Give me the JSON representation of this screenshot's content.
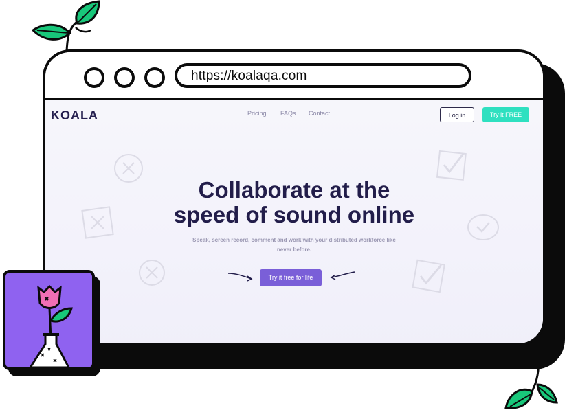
{
  "browser": {
    "url": "https://koalaqa.com"
  },
  "site": {
    "logo": "KOALA",
    "nav": [
      "Pricing",
      "FAQs",
      "Contact"
    ],
    "login_label": "Log in",
    "try_label": "Try it FREE",
    "hero_line1": "Collaborate at the",
    "hero_line2": "speed of sound online",
    "subtitle_line1": "Speak, screen record, comment and work with your distributed workforce like",
    "subtitle_line2": "never before.",
    "cta_label": "Try it free for life"
  },
  "colors": {
    "frame": "#0b0b0b",
    "leaf_green": "#18c77a",
    "accent_teal": "#2fe0c0",
    "accent_purple": "#7a5fd8",
    "panel_purple": "#8f62f0",
    "flower_pink": "#f06fb4",
    "navy_text": "#221d4a"
  },
  "icons": [
    "leaf-branch-icon",
    "flower-vase-icon",
    "check-box-icon",
    "x-mark-icon",
    "arrow-icon"
  ]
}
